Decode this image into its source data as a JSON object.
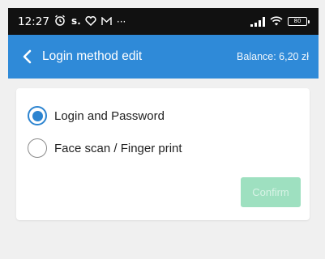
{
  "status_bar": {
    "time": "12:27",
    "icons": [
      "alarm-icon",
      "s-app-icon",
      "heart-icon",
      "mail-icon",
      "more-icon"
    ],
    "more_glyph": "···",
    "right_icons": [
      "signal-icon",
      "wifi-icon",
      "battery-icon"
    ],
    "battery_level": "80"
  },
  "app_bar": {
    "title": "Login method edit",
    "balance": "Balance: 6,20 zł",
    "back_icon": "chevron-left-icon",
    "color": "#2f8ad8"
  },
  "options": [
    {
      "label": "Login and Password",
      "checked": true
    },
    {
      "label": "Face scan / Finger print",
      "checked": false
    }
  ],
  "confirm": {
    "label": "Confirm",
    "enabled": false,
    "color": "#9ee0c0"
  },
  "colors": {
    "accent": "#2c84d0",
    "background": "#f0f0f0"
  }
}
